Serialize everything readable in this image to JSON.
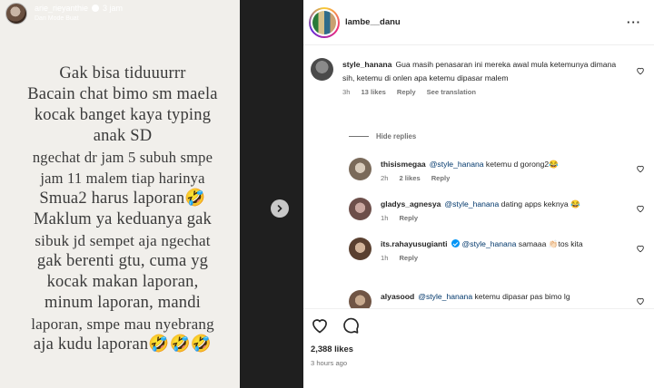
{
  "story": {
    "username": "arie_rieyanthie",
    "time": "3 jam",
    "subtitle": "Dari Mode Buat",
    "lines": [
      "Gak bisa tiduuurrr",
      "Bacain chat bimo sm maela",
      "kocak banget kaya typing",
      "anak SD",
      "ngechat dr jam 5 subuh smpe",
      "jam 11 malem tiap harinya",
      "Smua2 harus laporan🤣",
      "Maklum ya keduanya gak",
      "sibuk jd sempet aja ngechat",
      "gak berenti gtu, cuma yg",
      "kocak makan laporan,",
      "minum laporan, mandi",
      "laporan, smpe mau nyebrang",
      "aja kudu laporan🤣🤣🤣"
    ]
  },
  "post": {
    "username": "lambe__danu",
    "likes": "2,388 likes",
    "timeago": "3 hours ago"
  },
  "comments": [
    {
      "user": "style_hanana",
      "text": "Gua masih penasaran ini mereka awal mula ketemunya dimana sih, ketemu di onlen apa ketemu dipasar malem",
      "time": "3h",
      "likes": "13 likes",
      "reply": "Reply",
      "translate": "See translation"
    }
  ],
  "hide_replies": "Hide replies",
  "replies": [
    {
      "user": "thisismegaa",
      "mention": "@style_hanana",
      "text": " ketemu d gorong2😂",
      "time": "2h",
      "likes": "2 likes",
      "reply": "Reply"
    },
    {
      "user": "gladys_agnesya",
      "mention": "@style_hanana",
      "text": " dating apps keknya 😂",
      "time": "1h",
      "reply": "Reply"
    },
    {
      "user": "its.rahayusugianti",
      "mention": "@style_hanana",
      "text": " samaaa 👏🏻tos kita",
      "time": "1h",
      "reply": "Reply"
    },
    {
      "user": "alyasood",
      "mention": "@style_hanana",
      "text": " ketemu dipasar pas bimo lg"
    }
  ],
  "colors": {
    "mention": "#00376b",
    "verified": "#0095f6"
  }
}
